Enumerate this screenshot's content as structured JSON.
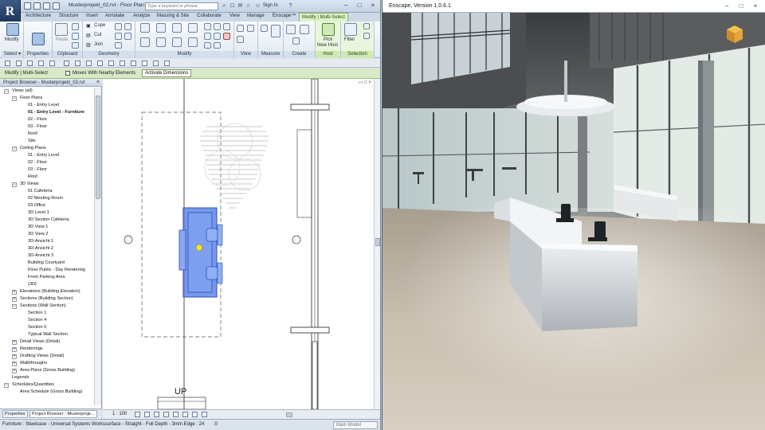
{
  "revit": {
    "app_icon": "R",
    "window_title": "Musterprojekt_02.rvt - Floor Plan: 01 - Entry Level - F...",
    "search_placeholder": "Type a keyword or phrase",
    "sign_in": "Sign In",
    "tabs": [
      "Architecture",
      "Structure",
      "Insert",
      "Annotate",
      "Analyze",
      "Massing & Site",
      "Collaborate",
      "View",
      "Manage",
      "Enscape™",
      "Modify | Multi-Select"
    ],
    "panels": {
      "select": {
        "label": "Select ▾",
        "modify": "Modify"
      },
      "properties": {
        "label": "Properties",
        "btn": "Properties"
      },
      "clipboard": {
        "label": "Clipboard",
        "paste": "Paste"
      },
      "geometry": {
        "label": "Geometry",
        "cope": "Cope",
        "cut": "Cut",
        "join": "Join"
      },
      "modify": {
        "label": "Modify"
      },
      "view": {
        "label": "View"
      },
      "measure": {
        "label": "Measure"
      },
      "create": {
        "label": "Create"
      },
      "host": {
        "label": "Host",
        "pick": "Pick",
        "new_host": "New Host"
      },
      "selection": {
        "label": "Selection",
        "filter": "Filter"
      }
    },
    "options_bar": {
      "mode": "Modify | Multi-Select",
      "moves_label": "Moves With Nearby Elements",
      "activate_dimensions": "Activate Dimensions"
    },
    "project_browser": {
      "title": "Project Browser - Musterprojekt_02.rvt",
      "close": "×",
      "tree": [
        {
          "label": "Views (all)",
          "indent": 0,
          "exp": "−",
          "bold": false
        },
        {
          "label": "Floor Plans",
          "indent": 1,
          "exp": "−",
          "bold": false
        },
        {
          "label": "01 - Entry Level",
          "indent": 2,
          "exp": "",
          "bold": false
        },
        {
          "label": "01 - Entry Level - Furniture",
          "indent": 2,
          "exp": "",
          "bold": true
        },
        {
          "label": "02 - Floor",
          "indent": 2,
          "exp": "",
          "bold": false
        },
        {
          "label": "03 - Floor",
          "indent": 2,
          "exp": "",
          "bold": false
        },
        {
          "label": "Roof",
          "indent": 2,
          "exp": "",
          "bold": false
        },
        {
          "label": "Site",
          "indent": 2,
          "exp": "",
          "bold": false
        },
        {
          "label": "Ceiling Plans",
          "indent": 1,
          "exp": "−",
          "bold": false
        },
        {
          "label": "01 - Entry Level",
          "indent": 2,
          "exp": "",
          "bold": false
        },
        {
          "label": "02 - Floor",
          "indent": 2,
          "exp": "",
          "bold": false
        },
        {
          "label": "03 - Floor",
          "indent": 2,
          "exp": "",
          "bold": false
        },
        {
          "label": "Roof",
          "indent": 2,
          "exp": "",
          "bold": false
        },
        {
          "label": "3D Views",
          "indent": 1,
          "exp": "−",
          "bold": false
        },
        {
          "label": "01 Cafeteria",
          "indent": 2,
          "exp": "",
          "bold": false
        },
        {
          "label": "02 Meeting Room",
          "indent": 2,
          "exp": "",
          "bold": false
        },
        {
          "label": "03 Office",
          "indent": 2,
          "exp": "",
          "bold": false
        },
        {
          "label": "3D Level 1",
          "indent": 2,
          "exp": "",
          "bold": false
        },
        {
          "label": "3D Section Cafeteria",
          "indent": 2,
          "exp": "",
          "bold": false
        },
        {
          "label": "3D View 1",
          "indent": 2,
          "exp": "",
          "bold": false
        },
        {
          "label": "3D View 2",
          "indent": 2,
          "exp": "",
          "bold": false
        },
        {
          "label": "3D-Ansicht 1",
          "indent": 2,
          "exp": "",
          "bold": false
        },
        {
          "label": "3D-Ansicht 2",
          "indent": 2,
          "exp": "",
          "bold": false
        },
        {
          "label": "3D-Ansicht 3",
          "indent": 2,
          "exp": "",
          "bold": false
        },
        {
          "label": "Building Courtyard",
          "indent": 2,
          "exp": "",
          "bold": false
        },
        {
          "label": "Floor Public - Day Rendering",
          "indent": 2,
          "exp": "",
          "bold": false
        },
        {
          "label": "From Parking Area",
          "indent": 2,
          "exp": "",
          "bold": false
        },
        {
          "label": "{3D}",
          "indent": 2,
          "exp": "",
          "bold": false
        },
        {
          "label": "Elevations (Building Elevation)",
          "indent": 1,
          "exp": "+",
          "bold": false
        },
        {
          "label": "Sections (Building Section)",
          "indent": 1,
          "exp": "+",
          "bold": false
        },
        {
          "label": "Sections (Wall Section)",
          "indent": 1,
          "exp": "−",
          "bold": false
        },
        {
          "label": "Section 1",
          "indent": 2,
          "exp": "",
          "bold": false
        },
        {
          "label": "Section 4",
          "indent": 2,
          "exp": "",
          "bold": false
        },
        {
          "label": "Section 6",
          "indent": 2,
          "exp": "",
          "bold": false
        },
        {
          "label": "Typical Wall Section",
          "indent": 2,
          "exp": "",
          "bold": false
        },
        {
          "label": "Detail Views (Detail)",
          "indent": 1,
          "exp": "+",
          "bold": false
        },
        {
          "label": "Renderings",
          "indent": 1,
          "exp": "+",
          "bold": false
        },
        {
          "label": "Drafting Views (Detail)",
          "indent": 1,
          "exp": "+",
          "bold": false
        },
        {
          "label": "Walkthroughs",
          "indent": 1,
          "exp": "+",
          "bold": false
        },
        {
          "label": "Area Plans (Gross Building)",
          "indent": 1,
          "exp": "+",
          "bold": false
        },
        {
          "label": "Legends",
          "indent": 0,
          "exp": "",
          "bold": false
        },
        {
          "label": "Schedules/Quantities",
          "indent": 0,
          "exp": "−",
          "bold": false
        },
        {
          "label": "Area Schedule (Gross Building)",
          "indent": 1,
          "exp": "",
          "bold": false
        }
      ],
      "tabs": [
        "Properties",
        "Project Browser - Musterproje..."
      ]
    },
    "canvas": {
      "controls": "▭ □ ×",
      "stair_label": "UP"
    },
    "view_control": {
      "scale": "1 : 100"
    },
    "status_bar": {
      "text": "Furniture : Steelcase - Universal Systems Workssurface - Straight - Full Depth - 3mm Edge : 24",
      "zero": ":0",
      "model": "Main Model"
    },
    "colors": {
      "selection": "#4a6fd6",
      "context_tab": "#dff3c9",
      "ribbon": "#e3eaf2"
    }
  },
  "enscape": {
    "window_title": "Enscape, Version 1.0.6.1",
    "logo": "enscape-cube-icon"
  }
}
